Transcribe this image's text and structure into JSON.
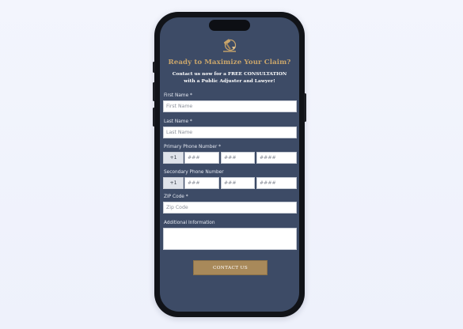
{
  "form": {
    "title": "Ready to Maximize Your Claim?",
    "subtitle": "Contact us now for a FREE CONSULTATION with a Public Adjuster and Lawyer!",
    "first_name": {
      "label": "First Name *",
      "placeholder": "First Name"
    },
    "last_name": {
      "label": "Last Name *",
      "placeholder": "Last Name"
    },
    "primary_phone": {
      "label": "Primary Phone Number *",
      "prefix": "+1",
      "area_placeholder": "###",
      "exchange_placeholder": "###",
      "line_placeholder": "####"
    },
    "secondary_phone": {
      "label": "Secondary Phone Number",
      "prefix": "+1",
      "area_placeholder": "###",
      "exchange_placeholder": "###",
      "line_placeholder": "####"
    },
    "zip": {
      "label": "ZIP Code *",
      "placeholder": "Zip Code"
    },
    "additional": {
      "label": "Additional Information",
      "value": ""
    },
    "submit_label": "CONTACT US"
  },
  "logo": {
    "icon": "gavel-scale-logo-icon",
    "color": "#c9a56b"
  },
  "colors": {
    "page_background": "#eef1fb",
    "screen_background": "#3d4b66",
    "accent_gold": "#c9a56b",
    "button": "#a8895a"
  }
}
